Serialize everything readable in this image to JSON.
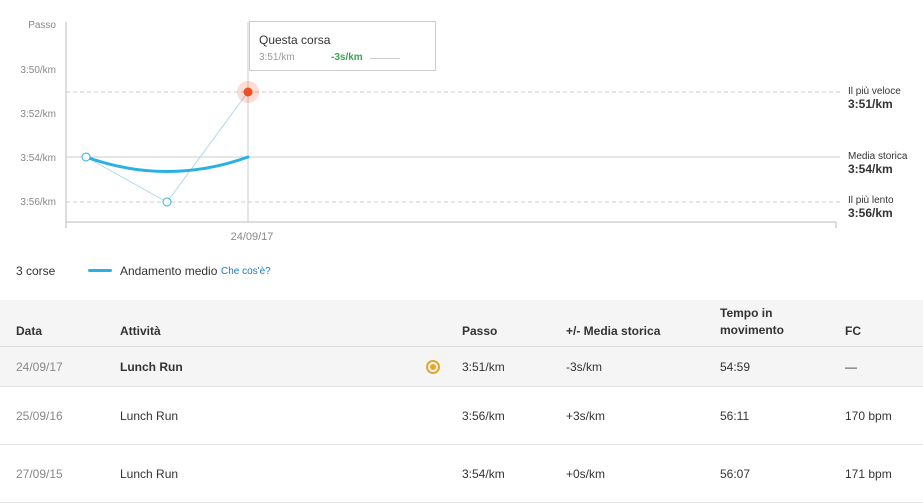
{
  "chart": {
    "y_title": "Passo",
    "y_ticks": [
      "3:50/km",
      "3:52/km",
      "3:54/km",
      "3:56/km"
    ],
    "x_tick": "24/09/17",
    "colors": {
      "trend": "#29b1e3",
      "current": "#f04e23",
      "axis": "#bbb"
    }
  },
  "tooltip": {
    "title": "Questa corsa",
    "value": "3:51/km",
    "delta": "-3s/km"
  },
  "refs": {
    "fastest_label": "Il più veloce",
    "fastest_value": "3:51/km",
    "avg_label": "Media storica",
    "avg_value": "3:54/km",
    "slowest_label": "Il più lento",
    "slowest_value": "3:56/km"
  },
  "legend": {
    "count": "3 corse",
    "label": "Andamento medio",
    "link": "Che cos'è?"
  },
  "table": {
    "headers": {
      "date": "Data",
      "activity": "Attività",
      "pace": "Passo",
      "diff": "+/- Media storica",
      "time": "Tempo in movimento",
      "hr": "FC"
    },
    "rows": [
      {
        "date": "24/09/17",
        "activity": "Lunch Run",
        "pace": "3:51/km",
        "diff": "-3s/km",
        "time": "54:59",
        "hr": "—"
      },
      {
        "date": "25/09/16",
        "activity": "Lunch Run",
        "pace": "3:56/km",
        "diff": "+3s/km",
        "time": "56:11",
        "hr": "170 bpm"
      },
      {
        "date": "27/09/15",
        "activity": "Lunch Run",
        "pace": "3:54/km",
        "diff": "+0s/km",
        "time": "56:07",
        "hr": "171 bpm"
      }
    ]
  },
  "chart_data": {
    "type": "line",
    "x": [
      "27/09/15",
      "25/09/16",
      "24/09/17"
    ],
    "series": [
      {
        "values": [
          "3:54",
          "3:56",
          "3:51"
        ]
      },
      {
        "name": "Andamento medio",
        "values": [
          "3:54",
          "3:55",
          "3:54"
        ]
      }
    ],
    "ylabel": "Passo",
    "y_ticks": [
      "3:50/km",
      "3:52/km",
      "3:54/km",
      "3:56/km"
    ],
    "reference_lines": [
      {
        "label": "Il più veloce",
        "value": "3:51/km"
      },
      {
        "label": "Media storica",
        "value": "3:54/km"
      },
      {
        "label": "Il più lento",
        "value": "3:56/km"
      }
    ]
  }
}
